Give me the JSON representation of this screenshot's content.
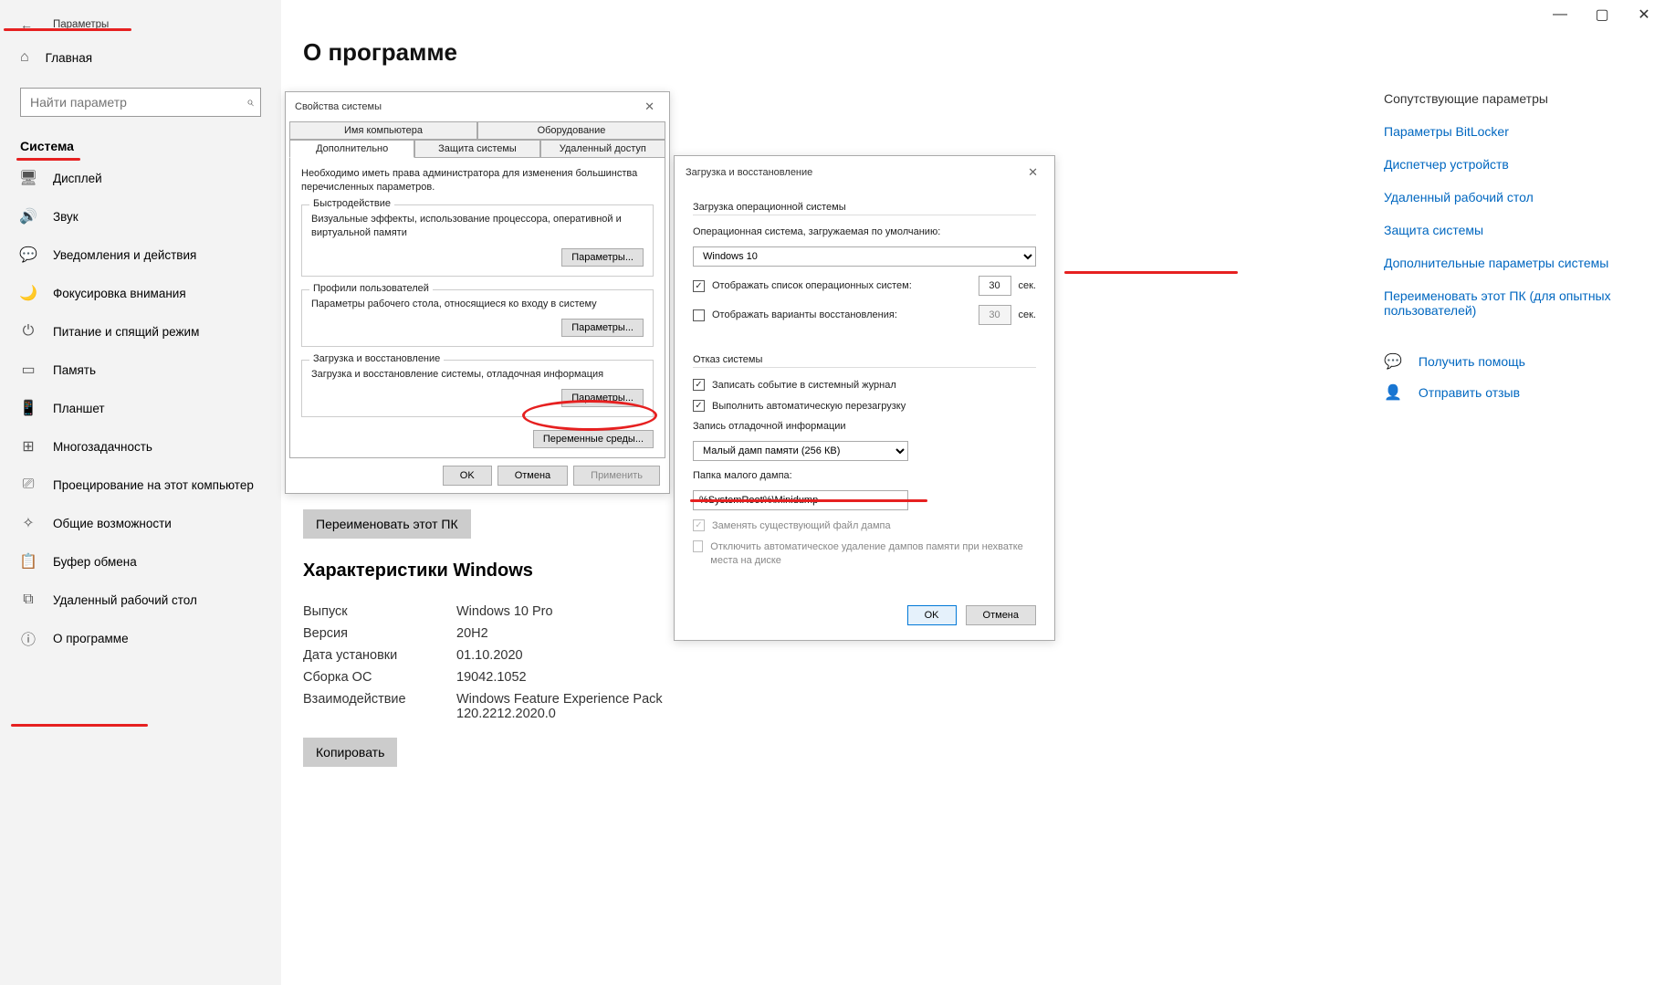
{
  "window_controls": {
    "min": "—",
    "max": "▢",
    "close": "✕"
  },
  "sidebar": {
    "back_title": "Параметры",
    "home": "Главная",
    "search_placeholder": "Найти параметр",
    "section": "Система",
    "items": [
      {
        "icon": "🖥",
        "label": "Дисплей"
      },
      {
        "icon": "🔊",
        "label": "Звук"
      },
      {
        "icon": "💬",
        "label": "Уведомления и действия"
      },
      {
        "icon": "🌙",
        "label": "Фокусировка внимания"
      },
      {
        "icon": "⏻",
        "label": "Питание и спящий режим"
      },
      {
        "icon": "▭",
        "label": "Память"
      },
      {
        "icon": "📱",
        "label": "Планшет"
      },
      {
        "icon": "⊞",
        "label": "Многозадачность"
      },
      {
        "icon": "⎚",
        "label": "Проецирование на этот компьютер"
      },
      {
        "icon": "✧",
        "label": "Общие возможности"
      },
      {
        "icon": "📋",
        "label": "Буфер обмена"
      },
      {
        "icon": "⧉",
        "label": "Удаленный рабочий стол"
      },
      {
        "icon": "ⓘ",
        "label": "О программе"
      }
    ]
  },
  "main": {
    "title": "О программе",
    "rename_btn": "Переименовать этот ПК",
    "specs_head": "Характеристики Windows",
    "specs": [
      {
        "k": "Выпуск",
        "v": "Windows 10 Pro"
      },
      {
        "k": "Версия",
        "v": "20H2"
      },
      {
        "k": "Дата установки",
        "v": "01.10.2020"
      },
      {
        "k": "Сборка ОС",
        "v": "19042.1052"
      },
      {
        "k": "Взаимодействие",
        "v": "Windows Feature Experience Pack 120.2212.2020.0"
      }
    ],
    "copy_btn": "Копировать"
  },
  "related": {
    "title": "Сопутствующие параметры",
    "links": [
      "Параметры BitLocker",
      "Диспетчер устройств",
      "Удаленный рабочий стол",
      "Защита системы",
      "Дополнительные параметры системы",
      "Переименовать этот ПК (для опытных пользователей)"
    ],
    "help": "Получить помощь",
    "feedback": "Отправить отзыв"
  },
  "sysprop": {
    "title": "Свойства системы",
    "tabs_row1": [
      "Имя компьютера",
      "Оборудование"
    ],
    "tabs_row2": [
      "Дополнительно",
      "Защита системы",
      "Удаленный доступ"
    ],
    "desc": "Необходимо иметь права администратора для изменения большинства перечисленных параметров.",
    "fs1_lbl": "Быстродействие",
    "fs1_txt": "Визуальные эффекты, использование процессора, оперативной и виртуальной памяти",
    "fs2_lbl": "Профили пользователей",
    "fs2_txt": "Параметры рабочего стола, относящиеся ко входу в систему",
    "fs3_lbl": "Загрузка и восстановление",
    "fs3_txt": "Загрузка и восстановление системы, отладочная информация",
    "param_btn": "Параметры...",
    "env_btn": "Переменные среды...",
    "ok": "OK",
    "cancel": "Отмена",
    "apply": "Применить"
  },
  "boot": {
    "title": "Загрузка и восстановление",
    "sec1": "Загрузка операционной системы",
    "os_lbl": "Операционная система, загружаемая по умолчанию:",
    "os_val": "Windows 10",
    "chk1": "Отображать список операционных систем:",
    "chk2": "Отображать варианты восстановления:",
    "sec": "сек.",
    "t1": "30",
    "t2": "30",
    "sec2": "Отказ системы",
    "chk3": "Записать событие в системный журнал",
    "chk4": "Выполнить автоматическую перезагрузку",
    "debug_lbl": "Запись отладочной информации",
    "debug_val": "Малый дамп памяти (256 КВ)",
    "dump_lbl": "Папка малого дампа:",
    "dump_val": "%SystemRoot%\\Minidump",
    "chk5": "Заменять существующий файл дампа",
    "chk6": "Отключить автоматическое удаление дампов памяти при нехватке места на диске",
    "ok": "OK",
    "cancel": "Отмена"
  }
}
